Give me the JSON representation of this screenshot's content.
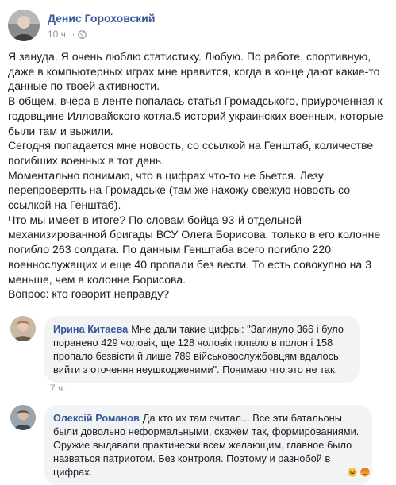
{
  "post": {
    "author": "Денис Гороховский",
    "time": "10 ч.",
    "separator": "·",
    "paragraphs": [
      "Я зануда. Я очень люблю статистику. Любую. По работе, спортивную,\nдаже в компьютерных играх мне нравится, когда в конце дают какие-то\nданные по твоей активности.",
      "В общем, вчера в ленте попалась статья Громадського, приуроченная к\nгодовщине Илловайского котла.5 историй украинских военных, которые\nбыли там и выжили.",
      "Сегодня попадается мне новость, со ссылкой на Генштаб, количестве\nпогибших военных в тот день.",
      "Моментально понимаю, что в цифрах что-то не бьется. Лезу\nперепроверять на Громадське (там же нахожу свежую новость со\nссылкой на Генштаб).",
      "Что мы имеет в итоге? По словам бойца 93-й отдельной\nмеханизированной бригады ВСУ Олега Борисова. только в его колонне\nпогибло 263 солдата. По данным Генштаба всего погибло 220\nвоеннослужащих и еще 40 пропали без вести. То есть совокупно на 3\nменьше, чем в колонне Борисова.",
      "Вопрос: кто говорит неправду?"
    ]
  },
  "comments": [
    {
      "name": "Ирина Китаева",
      "text": "Мне дали такие цифры: \"Загинуло 366 і було\nпоранено 429 чоловік, ще 128 чоловік попало в полон і 158\nпропало безвісти й лише 789 військовослужбовцям вдалось\nвийти з оточення неушкодженими\". Понимаю что это не так.",
      "time": "7 ч."
    },
    {
      "name": "Олексій Романов",
      "text": "Да кто их там считал... Все эти батальоны\nбыли довольно неформальными, скажем так, формированиями.\nОружие выдавали практически всем желающим, главное было\nназваться патриотом. Без контроля. Поэтому и разнобой в\nцифрах."
    }
  ],
  "colors": {
    "link": "#385898",
    "secondary": "#90949c",
    "bubble": "#f2f3f5"
  },
  "icons": [
    "globe-icon",
    "haha-reaction-icon",
    "angry-reaction-icon"
  ]
}
